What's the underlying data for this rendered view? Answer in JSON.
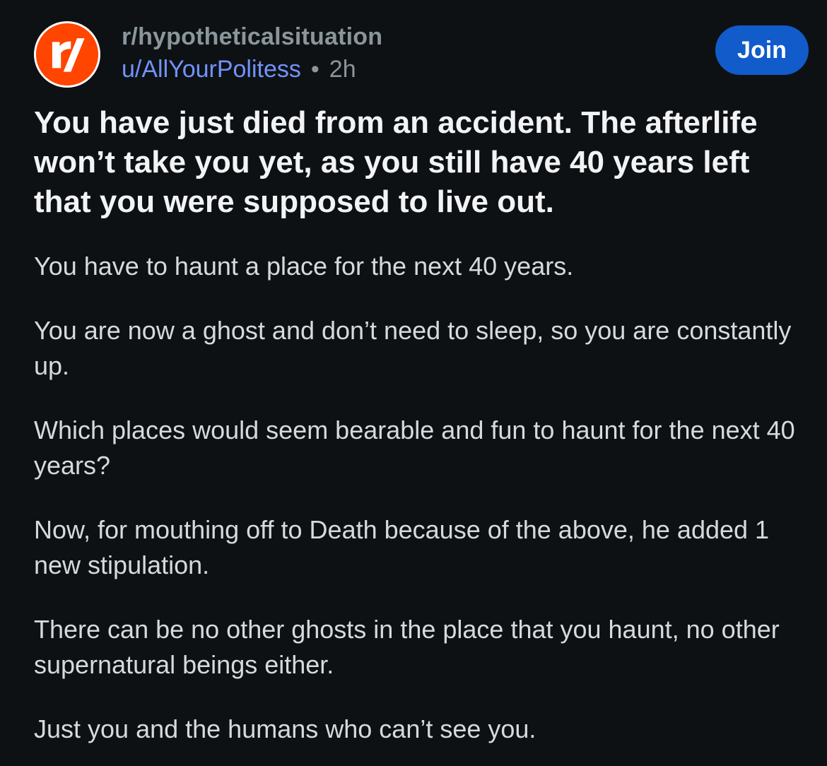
{
  "post": {
    "subreddit": "r/hypotheticalsituation",
    "username": "u/AllYourPolitess",
    "separator": "•",
    "age": "2h",
    "join_label": "Join",
    "title": "You have just died from an accident. The afterlife won’t take you yet, as you still have 40 years left that you were supposed to live out.",
    "paragraphs": [
      "You have to haunt a place for the next 40 years.",
      "You are now a ghost and don’t need to sleep, so you are constantly up.",
      "Which places would seem bearable and fun to haunt for the next 40 years?",
      "Now, for mouthing off to Death because of the above, he added 1 new stipulation.",
      "There can be no other ghosts in the place that you haunt, no other supernatural beings either.",
      "Just you and the humans who can’t see you."
    ]
  },
  "icons": {
    "avatar": "reddit-community-icon"
  },
  "colors": {
    "background": "#0e1113",
    "avatar": "#ff4500",
    "join_button": "#115bca",
    "username": "#7193ff",
    "muted": "#8a959c"
  }
}
